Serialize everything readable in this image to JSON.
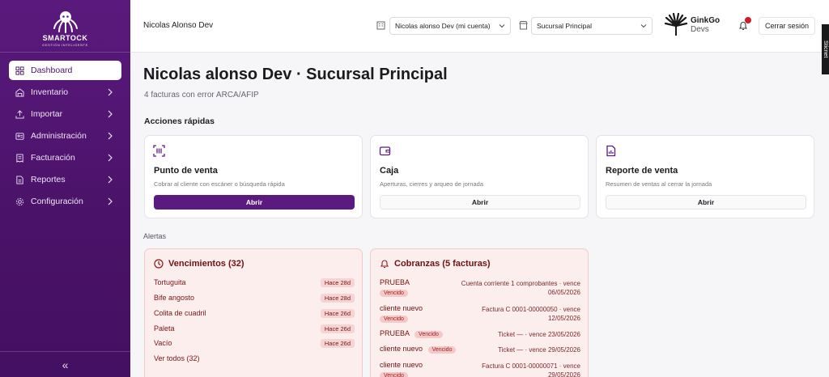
{
  "sidebar": {
    "brand": "SMARTOCK",
    "tagline": "GESTIÓN INTELIGENTE",
    "items": [
      {
        "label": "Dashboard",
        "icon": "dashboard-icon",
        "active": true
      },
      {
        "label": "Inventario",
        "icon": "warehouse-icon"
      },
      {
        "label": "Importar",
        "icon": "upload-icon"
      },
      {
        "label": "Administración",
        "icon": "id-card-icon"
      },
      {
        "label": "Facturación",
        "icon": "receipt-icon"
      },
      {
        "label": "Reportes",
        "icon": "document-icon"
      },
      {
        "label": "Configuración",
        "icon": "gear-icon"
      }
    ],
    "collapse": "«"
  },
  "header": {
    "user": "Nicolas Alonso Dev",
    "account_select": "Nicolas alonso Dev (mi cuenta)",
    "branch_select": "Sucursal Principal",
    "brand_name": "GinkGo",
    "brand_sub": "Devs",
    "logout": "Cerrar sesión",
    "side_tab": "Sticnet"
  },
  "main": {
    "title": "Nicolas alonso Dev · Sucursal Principal",
    "subtitle": "4 facturas con error ARCA/AFIP",
    "quick_title": "Acciones rápidas",
    "cards": [
      {
        "title": "Punto de venta",
        "desc": "Cobrar al cliente con escáner o búsqueda rápida",
        "button": "Abrir"
      },
      {
        "title": "Caja",
        "desc": "Aperturas, cierres y arqueo de jornada",
        "button": "Abrir"
      },
      {
        "title": "Reporte de venta",
        "desc": "Resumen de ventas al cerrar la jornada",
        "button": "Abrir"
      }
    ],
    "alerts_title": "Alertas",
    "vencimientos": {
      "title": "Vencimientos (32)",
      "rows": [
        {
          "name": "Tortuguita",
          "time": "Hace 28d"
        },
        {
          "name": "Bife angosto",
          "time": "Hace 28d"
        },
        {
          "name": "Colita de cuadril",
          "time": "Hace 26d"
        },
        {
          "name": "Paleta",
          "time": "Hace 26d"
        },
        {
          "name": "Vacío",
          "time": "Hace 26d"
        }
      ],
      "see_all": "Ver todos (32)"
    },
    "cobranzas": {
      "title": "Cobranzas (5 facturas)",
      "badge": "Vencido",
      "rows": [
        {
          "name": "PRUEBA",
          "info1": "Cuenta corriente 1 comprobantes · vence",
          "info2": "06/05/2026"
        },
        {
          "name": "cliente nuevo",
          "info1": "Factura C 0001-00000050 · vence",
          "info2": "12/05/2026"
        },
        {
          "name": "PRUEBA",
          "info1": "Ticket — · vence 23/05/2026",
          "info2": ""
        },
        {
          "name": "cliente nuevo",
          "info1": "Ticket — · vence 29/05/2026",
          "info2": ""
        },
        {
          "name": "cliente nuevo",
          "info1": "Factura C 0001-00000071 · vence",
          "info2": "29/05/2026"
        }
      ]
    }
  },
  "colors": {
    "sidebar": "#4a1368",
    "primary": "#5b1a80",
    "alert_bg": "#fdeeee",
    "alert_text": "#7a1414"
  }
}
